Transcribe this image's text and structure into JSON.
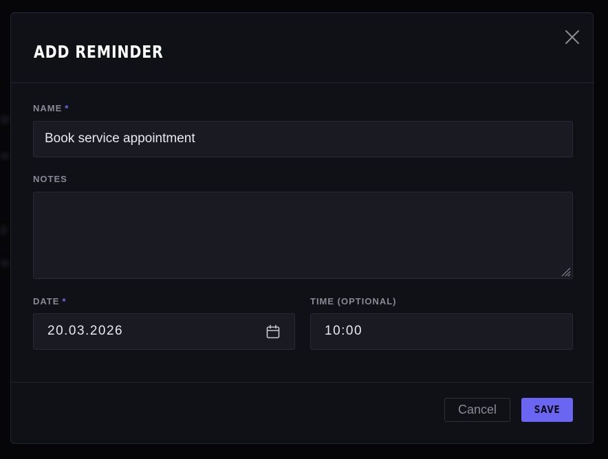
{
  "dialog": {
    "title": "ADD REMINDER",
    "close_icon": "close-icon"
  },
  "form": {
    "name": {
      "label": "NAME",
      "required_marker": "*",
      "value": "Book service appointment"
    },
    "notes": {
      "label": "NOTES",
      "value": ""
    },
    "date": {
      "label": "DATE",
      "required_marker": "*",
      "value": "20.03.2026",
      "icon": "calendar-icon"
    },
    "time": {
      "label": "TIME (OPTIONAL)",
      "value": "10:00"
    }
  },
  "footer": {
    "cancel_label": "Cancel",
    "save_label": "SAVE"
  },
  "colors": {
    "accent": "#6b66f2",
    "modal_bg": "#101017",
    "input_bg": "#1a1a23",
    "label": "#8a8a96"
  }
}
